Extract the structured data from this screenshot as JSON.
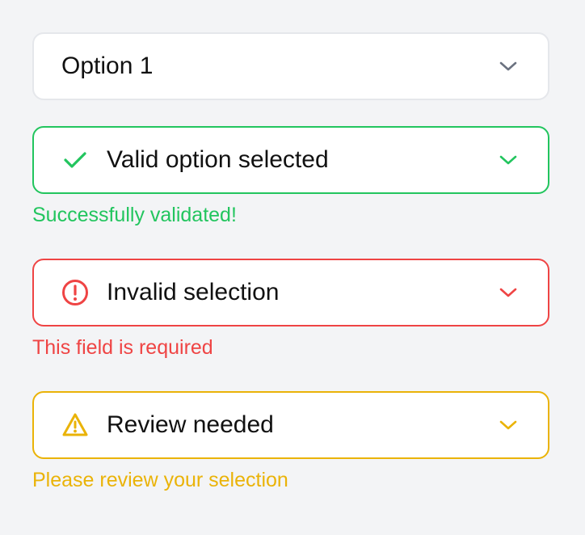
{
  "colors": {
    "background": "#f3f4f6",
    "default_border": "#e5e7eb",
    "default_chevron": "#6b7280",
    "success": "#22c55e",
    "error": "#ef4444",
    "warning": "#eab308"
  },
  "selects": [
    {
      "state": "default",
      "value": "Option 1",
      "icon": "chevron-down-icon",
      "helper": ""
    },
    {
      "state": "success",
      "value": "Valid option selected",
      "status_icon": "checkmark-icon",
      "icon": "chevron-down-icon",
      "helper": "Successfully validated!"
    },
    {
      "state": "error",
      "value": "Invalid selection",
      "status_icon": "alert-circle-icon",
      "icon": "chevron-down-icon",
      "helper": "This field is required"
    },
    {
      "state": "warning",
      "value": "Review needed",
      "status_icon": "warning-triangle-icon",
      "icon": "chevron-down-icon",
      "helper": "Please review your selection"
    }
  ]
}
